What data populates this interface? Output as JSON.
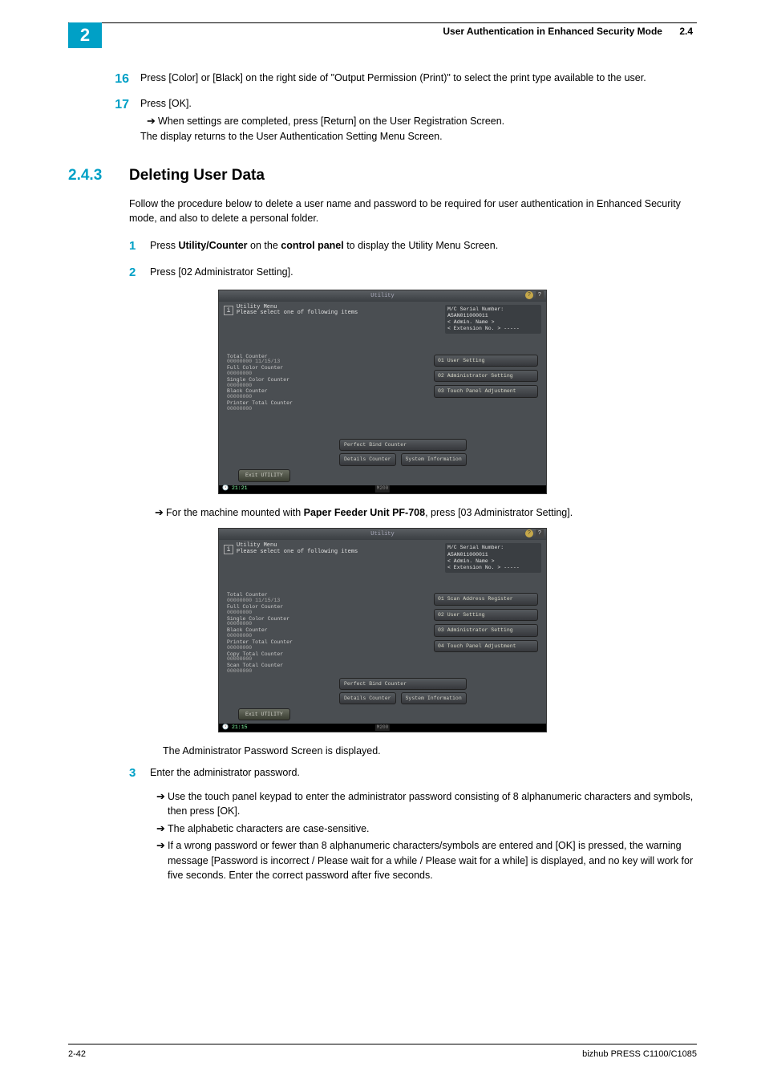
{
  "header": {
    "chapter": "2",
    "title": "User Authentication in Enhanced Security Mode",
    "section_ref": "2.4"
  },
  "step16": {
    "num": "16",
    "text": "Press [Color] or [Black] on the right side of \"Output Permission (Print)\" to select the print type available to the user."
  },
  "step17": {
    "num": "17",
    "text": "Press [OK].",
    "sub1": "When settings are completed, press [Return] on the User Registration Screen.",
    "sub2": "The display returns to the User Authentication Setting Menu Screen."
  },
  "section": {
    "num": "2.4.3",
    "title": "Deleting User Data",
    "intro": "Follow the procedure below to delete a user name and password to be required for user authentication in Enhanced Security mode, and also to delete a personal folder."
  },
  "s1": {
    "num": "1",
    "prefix": "Press ",
    "b1": "Utility/Counter",
    "mid": " on the ",
    "b2": "control panel",
    "suffix": " to display the Utility Menu Screen."
  },
  "s2": {
    "num": "2",
    "text": "Press [02 Administrator Setting]."
  },
  "note_pf708": {
    "prefix": "For the machine mounted with ",
    "b": "Paper Feeder Unit PF-708",
    "suffix": ", press [03 Administrator Setting]."
  },
  "admin_pw_displayed": "The Administrator Password Screen is displayed.",
  "s3": {
    "num": "3",
    "text": "Enter the administrator password.",
    "sub1": "Use the touch panel keypad to enter the administrator password consisting of 8 alphanumeric characters and symbols, then press [OK].",
    "sub2": "The alphabetic characters are case-sensitive.",
    "sub3": "If a wrong password or fewer than 8 alphanumeric characters/symbols are entered and [OK] is pressed, the warning message [Password is incorrect / Please wait for a while / Please wait for a while] is displayed, and no key will work for five seconds. Enter the correct password after five seconds."
  },
  "screenshot_common": {
    "utility": "Utility",
    "help": "?",
    "close": "?",
    "info": "i",
    "menu_title": "Utility Menu",
    "menu_sub": "Please select one of following items",
    "serial": "M/C Serial Number: A5AN011000011",
    "admin_name": "< Admin. Name >",
    "ext_no": "< Extension No. > -----",
    "perfect_bind": "Perfect Bind Counter",
    "details_counter": "Details Counter",
    "system_info": "System Information",
    "exit": "Exit UTILITY",
    "mem": "M200"
  },
  "ss1": {
    "counters": {
      "l1": "Total Counter",
      "v1": "00000000   11/15/13",
      "l2": "Full Color Counter",
      "v2": "00000000",
      "l3": "Single Color Counter",
      "v3": "00000000",
      "l4": "Black Counter",
      "v4": "00000000",
      "l5": "Printer Total Counter",
      "v5": "00000000"
    },
    "menu": {
      "m1": "01 User Setting",
      "m2": "02 Administrator Setting",
      "m3": "03 Touch Panel Adjustment"
    },
    "time": "21:21"
  },
  "ss2": {
    "counters": {
      "l1": "Total Counter",
      "v1": "00000000   11/15/13",
      "l2": "Full Color Counter",
      "v2": "00000000",
      "l3": "Single Color Counter",
      "v3": "00000000",
      "l4": "Black Counter",
      "v4": "00000000",
      "l5": "Printer Total Counter",
      "v5": "00000000",
      "l6": "Copy Total Counter",
      "v6": "00000000",
      "l7": "Scan Total Counter",
      "v7": "00000000"
    },
    "menu": {
      "m1": "01 Scan Address Register",
      "m2": "02 User Setting",
      "m3": "03 Administrator Setting",
      "m4": "04 Touch Panel Adjustment"
    },
    "time": "21:15"
  },
  "footer": {
    "left": "2-42",
    "right": "bizhub PRESS C1100/C1085"
  }
}
